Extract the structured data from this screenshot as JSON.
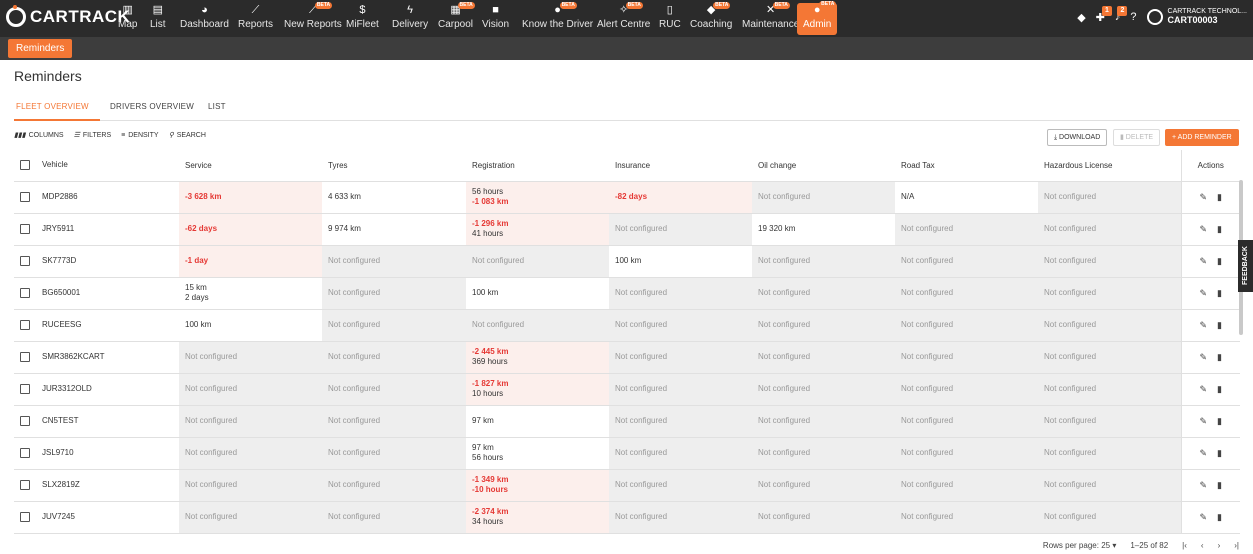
{
  "brand": "CARTRACK",
  "nav": [
    {
      "label": "Map",
      "icon": "map-icon",
      "glyph": "▥"
    },
    {
      "label": "List",
      "icon": "list-icon",
      "glyph": "▤"
    },
    {
      "label": "Dashboard",
      "icon": "dashboard-icon",
      "glyph": "◕"
    },
    {
      "label": "Reports",
      "icon": "reports-icon",
      "glyph": "⟋"
    },
    {
      "label": "New Reports",
      "icon": "new-reports-icon",
      "glyph": "⟋",
      "beta": "BETA"
    },
    {
      "label": "MiFleet",
      "icon": "dollar-icon",
      "glyph": "$"
    },
    {
      "label": "Delivery",
      "icon": "bolt-icon",
      "glyph": "ϟ"
    },
    {
      "label": "Carpool",
      "icon": "calendar-icon",
      "glyph": "▦",
      "beta": "BETA"
    },
    {
      "label": "Vision",
      "icon": "camera-icon",
      "glyph": "■"
    },
    {
      "label": "Know the Driver",
      "icon": "driver-icon",
      "glyph": "●",
      "beta": "BETA"
    },
    {
      "label": "Alert Centre",
      "icon": "alert-icon",
      "glyph": "✧",
      "beta": "BETA"
    },
    {
      "label": "RUC",
      "icon": "ruc-icon",
      "glyph": "▯"
    },
    {
      "label": "Coaching",
      "icon": "coaching-icon",
      "glyph": "◆",
      "beta": "BETA"
    },
    {
      "label": "Maintenance",
      "icon": "wrench-icon",
      "glyph": "✕",
      "beta": "BETA"
    },
    {
      "label": "Admin",
      "icon": "admin-icon",
      "glyph": "●",
      "beta": "BETA"
    }
  ],
  "badges": {
    "alerts": "1",
    "notifications": "2"
  },
  "account": {
    "company": "CARTRACK TECHNOL...",
    "code": "CART00003"
  },
  "subtab": "Reminders",
  "page_title": "Reminders",
  "tabs": [
    "FLEET OVERVIEW",
    "DRIVERS OVERVIEW",
    "LIST"
  ],
  "toolbar": {
    "columns": "COLUMNS",
    "filters": "FILTERS",
    "density": "DENSITY",
    "search": "SEARCH",
    "download": "DOWNLOAD",
    "delete": "DELETE",
    "add": "ADD REMINDER"
  },
  "feedback": "FEEDBACK",
  "columns": [
    "Vehicle",
    "Service",
    "Tyres",
    "Registration",
    "Insurance",
    "Oil change",
    "Road Tax",
    "Hazardous License",
    "Actions"
  ],
  "rows": [
    {
      "vehicle": "MDP2886",
      "cells": [
        [
          "-3 628 km"
        ],
        [
          "4 633 km"
        ],
        [
          "56 hours",
          "-1 083 km"
        ],
        [
          "-82 days"
        ],
        [
          "Not configured"
        ],
        [
          "N/A"
        ],
        [
          "Not configured"
        ]
      ]
    },
    {
      "vehicle": "JRY5911",
      "cells": [
        [
          "-62 days"
        ],
        [
          "9 974 km"
        ],
        [
          "-1 296 km",
          "41 hours"
        ],
        [
          "Not configured"
        ],
        [
          "19 320 km"
        ],
        [
          "Not configured"
        ],
        [
          "Not configured"
        ]
      ]
    },
    {
      "vehicle": "SK7773D",
      "cells": [
        [
          "-1 day"
        ],
        [
          "Not configured"
        ],
        [
          "Not configured"
        ],
        [
          "100 km"
        ],
        [
          "Not configured"
        ],
        [
          "Not configured"
        ],
        [
          "Not configured"
        ]
      ]
    },
    {
      "vehicle": "BG650001",
      "cells": [
        [
          "15 km",
          "2 days"
        ],
        [
          "Not configured"
        ],
        [
          "100 km"
        ],
        [
          "Not configured"
        ],
        [
          "Not configured"
        ],
        [
          "Not configured"
        ],
        [
          "Not configured"
        ]
      ]
    },
    {
      "vehicle": "RUCEESG",
      "cells": [
        [
          "100 km"
        ],
        [
          "Not configured"
        ],
        [
          "Not configured"
        ],
        [
          "Not configured"
        ],
        [
          "Not configured"
        ],
        [
          "Not configured"
        ],
        [
          "Not configured"
        ]
      ]
    },
    {
      "vehicle": "SMR3862KCART",
      "cells": [
        [
          "Not configured"
        ],
        [
          "Not configured"
        ],
        [
          "-2 445 km",
          "369 hours"
        ],
        [
          "Not configured"
        ],
        [
          "Not configured"
        ],
        [
          "Not configured"
        ],
        [
          "Not configured"
        ]
      ]
    },
    {
      "vehicle": "JUR3312OLD",
      "cells": [
        [
          "Not configured"
        ],
        [
          "Not configured"
        ],
        [
          "-1 827 km",
          "10 hours"
        ],
        [
          "Not configured"
        ],
        [
          "Not configured"
        ],
        [
          "Not configured"
        ],
        [
          "Not configured"
        ]
      ]
    },
    {
      "vehicle": "CN5TEST",
      "cells": [
        [
          "Not configured"
        ],
        [
          "Not configured"
        ],
        [
          "97 km"
        ],
        [
          "Not configured"
        ],
        [
          "Not configured"
        ],
        [
          "Not configured"
        ],
        [
          "Not configured"
        ]
      ]
    },
    {
      "vehicle": "JSL9710",
      "cells": [
        [
          "Not configured"
        ],
        [
          "Not configured"
        ],
        [
          "97 km",
          "56 hours"
        ],
        [
          "Not configured"
        ],
        [
          "Not configured"
        ],
        [
          "Not configured"
        ],
        [
          "Not configured"
        ]
      ]
    },
    {
      "vehicle": "SLX2819Z",
      "cells": [
        [
          "Not configured"
        ],
        [
          "Not configured"
        ],
        [
          "-1 349 km",
          "-10 hours"
        ],
        [
          "Not configured"
        ],
        [
          "Not configured"
        ],
        [
          "Not configured"
        ],
        [
          "Not configured"
        ]
      ]
    },
    {
      "vehicle": "JUV7245",
      "cells": [
        [
          "Not configured"
        ],
        [
          "Not configured"
        ],
        [
          "-2 374 km",
          "34 hours"
        ],
        [
          "Not configured"
        ],
        [
          "Not configured"
        ],
        [
          "Not configured"
        ],
        [
          "Not configured"
        ]
      ]
    }
  ],
  "footer": {
    "rows_per_page_label": "Rows per page:",
    "rows_per_page": "25",
    "range": "1–25 of 82"
  }
}
